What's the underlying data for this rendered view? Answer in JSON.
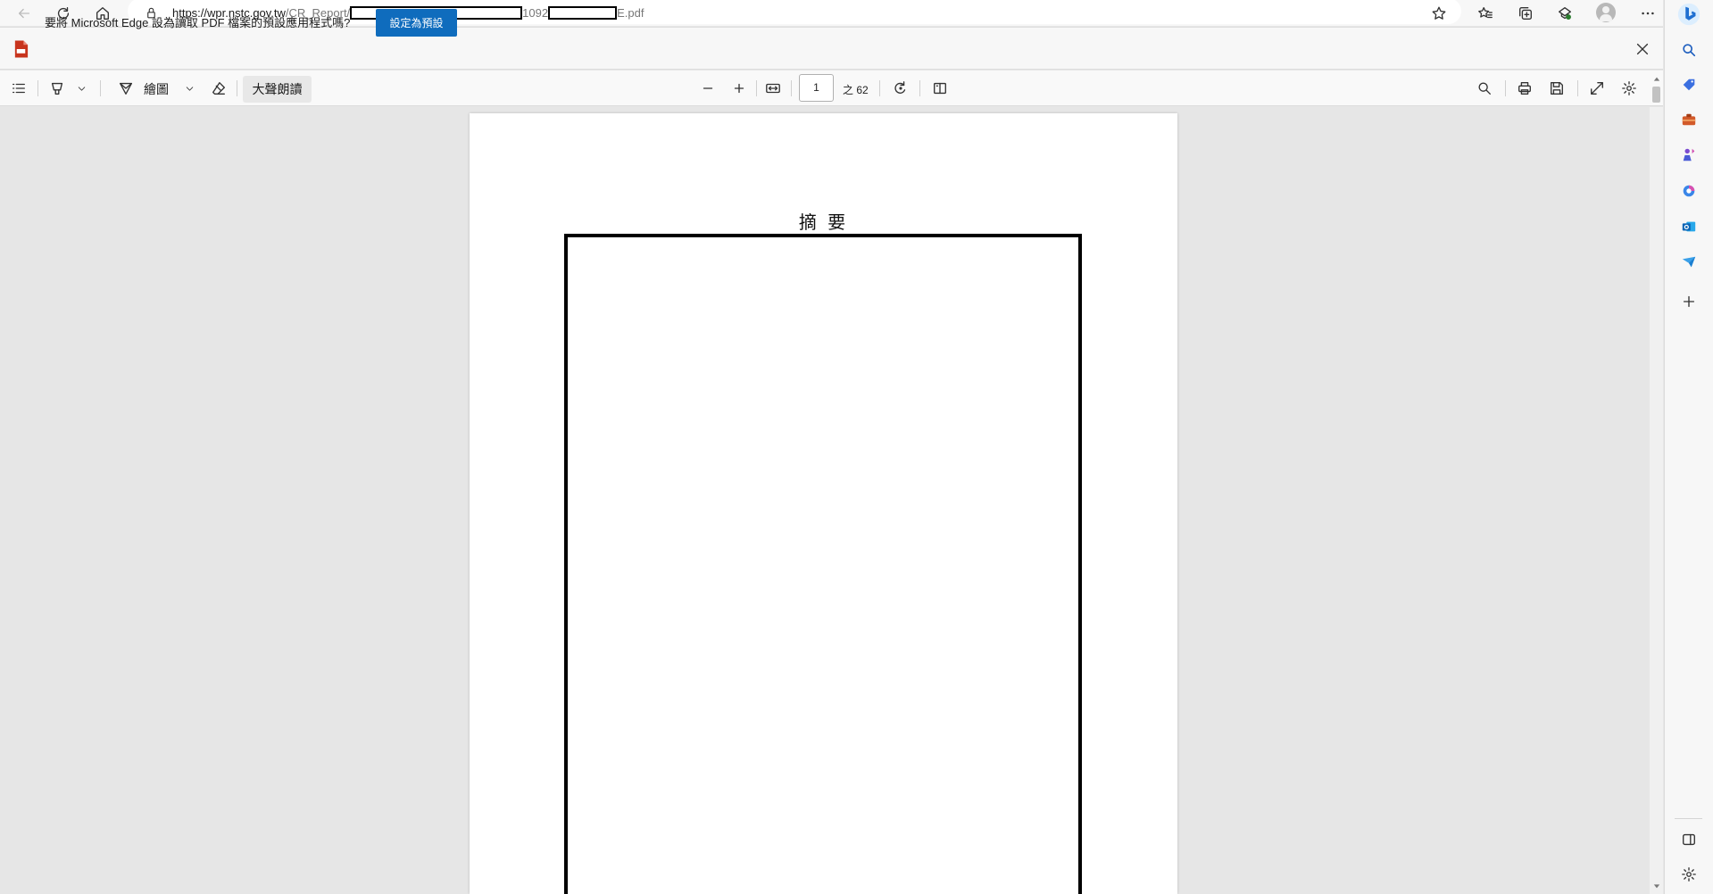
{
  "browser": {
    "url_host": "https://wpr.nstc.gov.tw",
    "url_path_visible_1": "/CR_Report/",
    "url_path_visible_2": "1092",
    "url_path_visible_3": "E.pdf"
  },
  "notification": {
    "message": "要將 Microsoft Edge 設為讀取 PDF 檔案的預設應用程式嗎?",
    "button_label": "設定為預設"
  },
  "pdf_toolbar": {
    "draw_label": "繪圖",
    "read_aloud_label": "大聲朗讀",
    "page_number": "1",
    "page_total": "之 62"
  },
  "document": {
    "heading": "摘 要"
  },
  "colors": {
    "primary_button": "#0f6cbd",
    "viewer_background": "#e6e6e6"
  },
  "icons": [
    "back-icon",
    "refresh-icon",
    "home-icon",
    "lock-icon",
    "favorite-star-icon",
    "favorites-icon",
    "collections-icon",
    "extensions-icon",
    "profile-avatar",
    "more-icon",
    "bing-icon",
    "pdf-file-icon",
    "close-icon",
    "contents-icon",
    "highlight-icon",
    "draw-icon",
    "eraser-icon",
    "zoom-out-icon",
    "zoom-in-icon",
    "fit-width-icon",
    "rotate-icon",
    "page-view-icon",
    "search-icon",
    "print-icon",
    "save-icon",
    "fullscreen-icon",
    "settings-icon"
  ]
}
